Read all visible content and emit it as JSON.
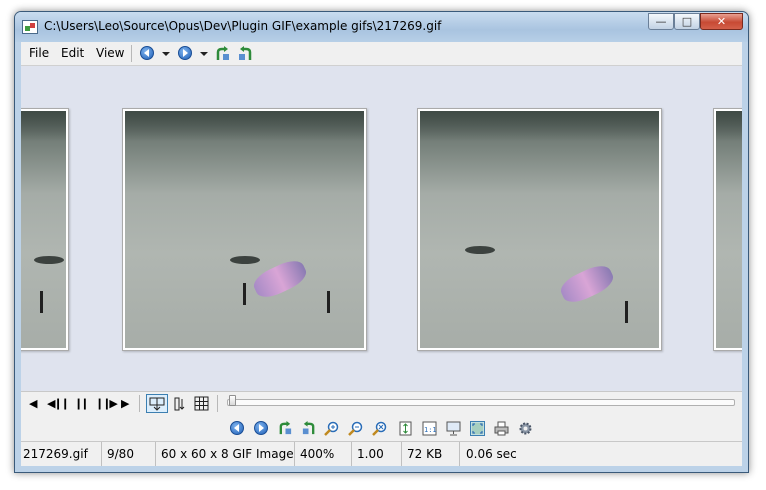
{
  "window": {
    "title": "C:\\Users\\Leo\\Source\\Opus\\Dev\\Plugin GIF\\example gifs\\217269.gif",
    "controls": {
      "minimize": "—",
      "maximize": "□",
      "close": "✕"
    }
  },
  "menu": {
    "file": "File",
    "edit": "Edit",
    "view": "View"
  },
  "toolbar_icons": {
    "prev": "previous-image-icon",
    "prev_dropdown": "chevron-down-icon",
    "next": "next-image-icon",
    "next_dropdown": "chevron-down-icon",
    "rotate_left": "rotate-left-icon",
    "rotate_right": "rotate-right-icon"
  },
  "playback": {
    "first": "◀",
    "step_back": "◀❙❙",
    "pause": "❙❙",
    "step_forward": "❙❙▶",
    "play": "▶",
    "frame_view": "frame-strip-icon",
    "sort": "sort-down-icon",
    "grid": "grid-icon",
    "position_fraction": 0.0
  },
  "status": {
    "filename": "217269.gif",
    "frame": "9/80",
    "image_info": "60 x 60 x 8 GIF Image",
    "zoom": "400%",
    "ratio": "1.00",
    "size": "72 KB",
    "delay": "0.06 sec"
  },
  "colors": {
    "accent": "#1f5fb6",
    "rotate": "#2e8b3a",
    "close": "#c74a34"
  }
}
